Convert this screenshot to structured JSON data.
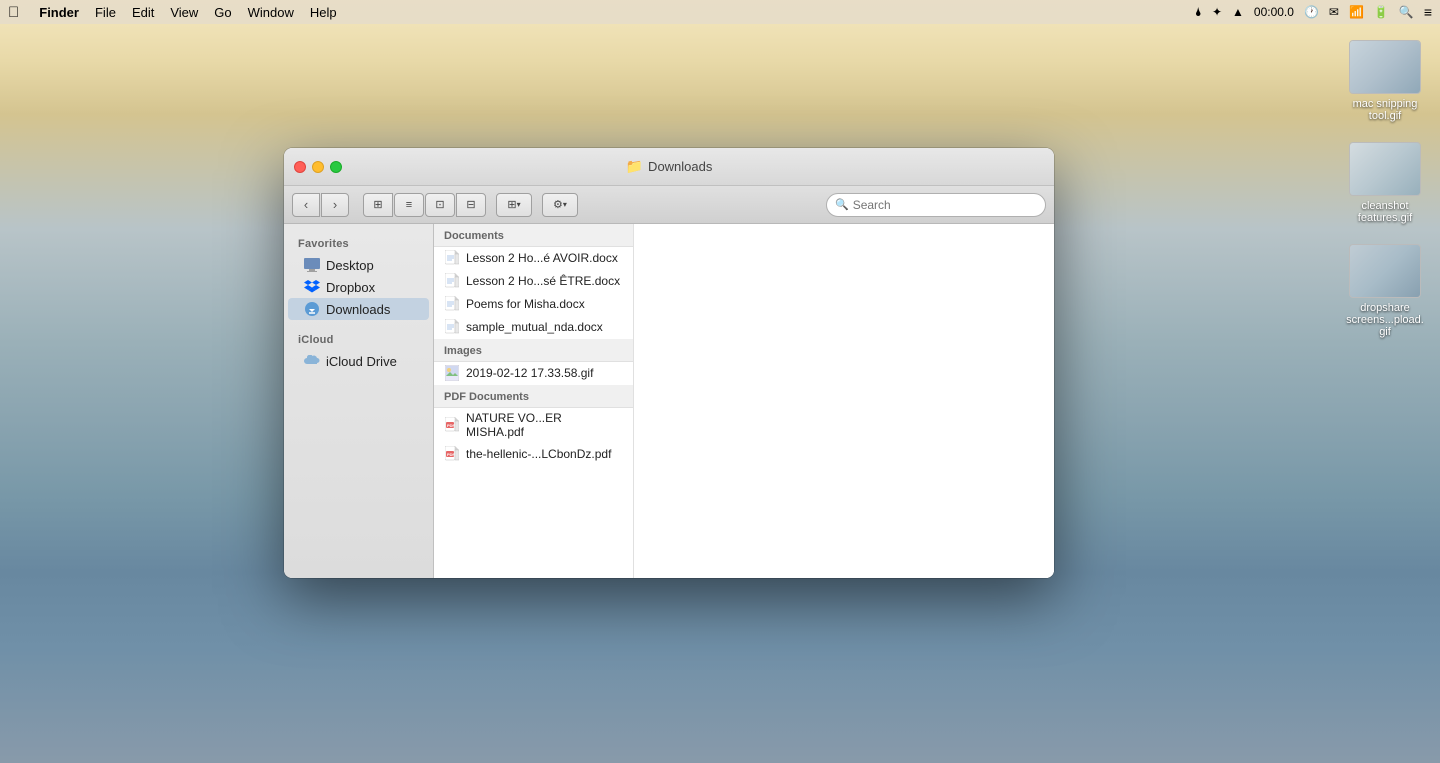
{
  "menubar": {
    "apple": "",
    "app_name": "Finder",
    "menus": [
      "File",
      "Edit",
      "View",
      "Go",
      "Window",
      "Help"
    ],
    "right": {
      "droplet": "🌢",
      "time": "00:00.0",
      "clock_icon": "🕐",
      "message_icon": "✉",
      "wifi_icon": "WiFi",
      "battery_icon": "🔋",
      "search_icon": "🔍",
      "list_icon": "≡"
    }
  },
  "window": {
    "title": "Downloads",
    "folder_icon": "📁"
  },
  "toolbar": {
    "back_label": "‹",
    "forward_label": "›",
    "view_icons": [
      "⊞",
      "≡",
      "⊡⊡",
      "⊟"
    ],
    "group_icon": "⊞",
    "gear_icon": "⚙",
    "search_placeholder": "Search"
  },
  "sidebar": {
    "favorites_label": "Favorites",
    "items": [
      {
        "id": "desktop",
        "label": "Desktop",
        "icon": "desktop"
      },
      {
        "id": "dropbox",
        "label": "Dropbox",
        "icon": "dropbox"
      },
      {
        "id": "downloads",
        "label": "Downloads",
        "icon": "downloads",
        "active": true
      }
    ],
    "icloud_label": "iCloud",
    "icloud_items": [
      {
        "id": "icloud-drive",
        "label": "iCloud Drive",
        "icon": "cloud"
      }
    ]
  },
  "files": {
    "documents_header": "Documents",
    "documents": [
      {
        "name": "Lesson 2 Ho...é AVOIR.docx",
        "type": "docx"
      },
      {
        "name": "Lesson 2 Ho...sé ÊTRE.docx",
        "type": "docx"
      },
      {
        "name": "Poems for Misha.docx",
        "type": "docx"
      },
      {
        "name": "sample_mutual_nda.docx",
        "type": "docx"
      }
    ],
    "images_header": "Images",
    "images": [
      {
        "name": "2019-02-12 17.33.58.gif",
        "type": "gif"
      }
    ],
    "pdf_header": "PDF Documents",
    "pdfs": [
      {
        "name": "NATURE VO...ER MISHA.pdf",
        "type": "pdf"
      },
      {
        "name": "the-hellenic-...LCbonDz.pdf",
        "type": "pdf"
      }
    ]
  },
  "desktop_files": [
    {
      "label": "mac snipping tool.gif",
      "thumb_type": "screenshot"
    },
    {
      "label": "cleanshot features.gif",
      "thumb_type": "screenshot"
    },
    {
      "label": "dropshare screens...pload.gif",
      "thumb_type": "screenshot"
    }
  ]
}
